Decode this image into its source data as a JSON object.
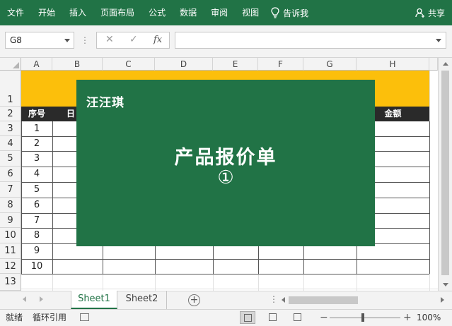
{
  "ribbon": {
    "tabs": [
      "文件",
      "开始",
      "插入",
      "页面布局",
      "公式",
      "数据",
      "审阅",
      "视图"
    ],
    "tell_me": "告诉我",
    "share": "共享",
    "accent_color": "#217346"
  },
  "formula_bar": {
    "name_box": "G8",
    "cancel_icon": "✕",
    "enter_icon": "✓",
    "fx_label": "fx",
    "formula_value": ""
  },
  "grid": {
    "columns": [
      "A",
      "B",
      "C",
      "D",
      "E",
      "F",
      "G",
      "H"
    ],
    "rows": [
      "1",
      "2",
      "3",
      "4",
      "5",
      "6",
      "7",
      "8",
      "9",
      "10",
      "11",
      "12",
      "13"
    ],
    "header_row": {
      "A": "序号",
      "B": "日",
      "H": "金额"
    },
    "seq_values": [
      "1",
      "2",
      "3",
      "4",
      "5",
      "6",
      "7",
      "8",
      "9",
      "10"
    ],
    "title_band_color": "#fcbf0b",
    "header_band_color": "#2a2a2a"
  },
  "overlay": {
    "brand": "汪汪琪",
    "title": "产品报价单",
    "number": "①"
  },
  "sheets": {
    "active": "Sheet1",
    "other": "Sheet2"
  },
  "status": {
    "ready": "就绪",
    "circular": "循环引用",
    "zoom": "100%"
  }
}
